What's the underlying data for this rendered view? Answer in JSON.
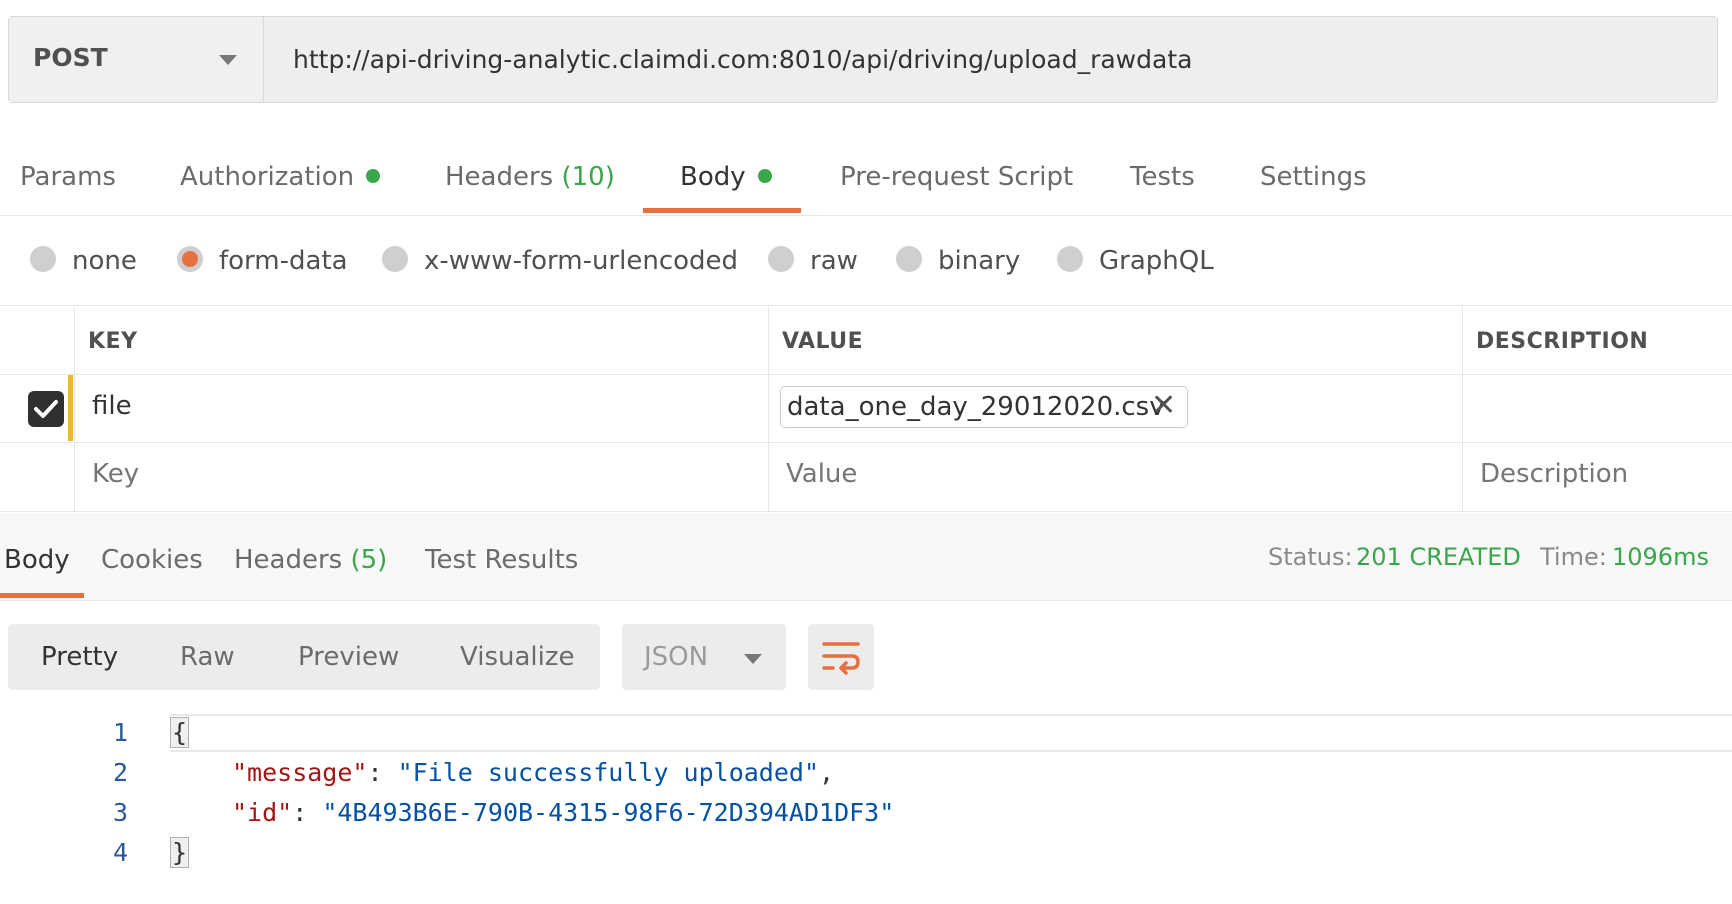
{
  "request": {
    "method": "POST",
    "url": "http://api-driving-analytic.claimdi.com:8010/api/driving/upload_rawdata"
  },
  "request_tabs": {
    "params": "Params",
    "authorization": "Authorization",
    "headers": "Headers",
    "headers_count": "(10)",
    "body": "Body",
    "prerequest": "Pre-request Script",
    "tests": "Tests",
    "settings": "Settings",
    "active": "Body",
    "indicator_color": "#3aa54a"
  },
  "body_types": {
    "options": [
      "none",
      "form-data",
      "x-www-form-urlencoded",
      "raw",
      "binary",
      "GraphQL"
    ],
    "selected": "form-data"
  },
  "params_table": {
    "headers": {
      "key": "KEY",
      "value": "VALUE",
      "description": "DESCRIPTION"
    },
    "rows": [
      {
        "checked": true,
        "key": "file",
        "value": "data_one_day_29012020.csv",
        "description": ""
      }
    ],
    "placeholders": {
      "key": "Key",
      "value": "Value",
      "description": "Description"
    }
  },
  "response": {
    "tabs": {
      "body": "Body",
      "cookies": "Cookies",
      "headers": "Headers",
      "headers_count": "(5)",
      "test_results": "Test Results",
      "active": "Body"
    },
    "status_label": "Status:",
    "status_value": "201 CREATED",
    "time_label": "Time:",
    "time_value": "1096ms",
    "format_buttons": [
      "Pretty",
      "Raw",
      "Preview",
      "Visualize"
    ],
    "active_format": "Pretty",
    "language": "JSON",
    "code": {
      "line_numbers": [
        "1",
        "2",
        "3",
        "4"
      ],
      "open_brace": "{",
      "close_brace": "}",
      "message_key": "\"message\"",
      "message_value": "\"File successfully uploaded\"",
      "id_key": "\"id\"",
      "id_value": "\"4B493B6E-790B-4315-98F6-72D394AD1DF3\""
    }
  },
  "colors": {
    "accent": "#e4713f",
    "success": "#3aa54a",
    "marker": "#f0b43c"
  }
}
